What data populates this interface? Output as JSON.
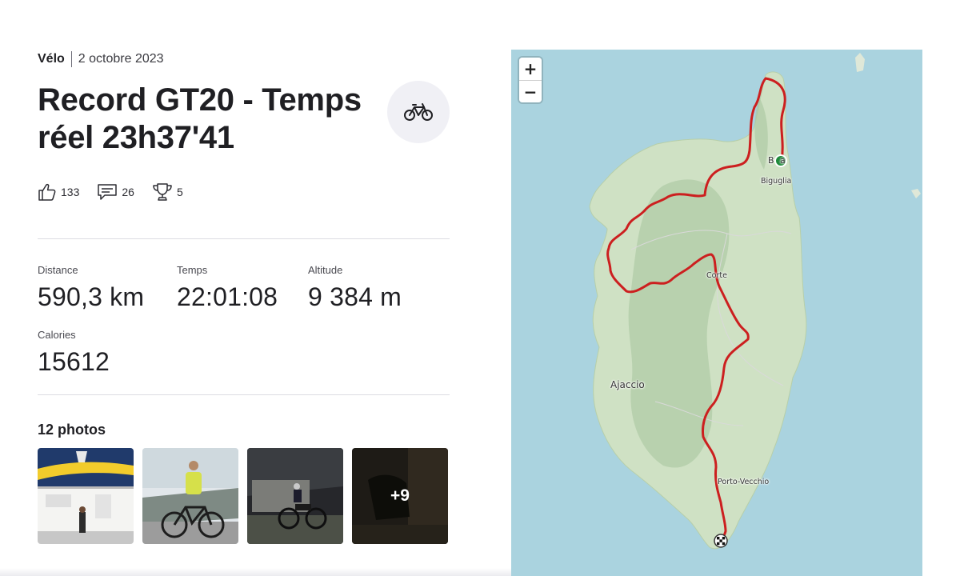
{
  "activity": {
    "sport": "Vélo",
    "date": "2 octobre 2023",
    "title": "Record GT20 - Temps réel 23h37'41",
    "sport_icon": "bike-icon"
  },
  "social": {
    "kudos": "133",
    "comments": "26",
    "achievements": "5"
  },
  "stats": {
    "distance": {
      "label": "Distance",
      "value": "590,3 km"
    },
    "time": {
      "label": "Temps",
      "value": "22:01:08"
    },
    "elevation": {
      "label": "Altitude",
      "value": "9 384 m"
    },
    "calories": {
      "label": "Calories",
      "value": "15612"
    }
  },
  "photos": {
    "heading": "12 photos",
    "more_label": "+9"
  },
  "map": {
    "zoom_in": "+",
    "zoom_out": "−",
    "places": {
      "bastia": "B a",
      "biguglia": "Biguglia",
      "corte": "Corte",
      "ajaccio": "Ajaccio",
      "porto_vecchio": "Porto-Vecchio"
    },
    "route_color": "#cc1f1f",
    "start_color": "#1e8a3a"
  }
}
